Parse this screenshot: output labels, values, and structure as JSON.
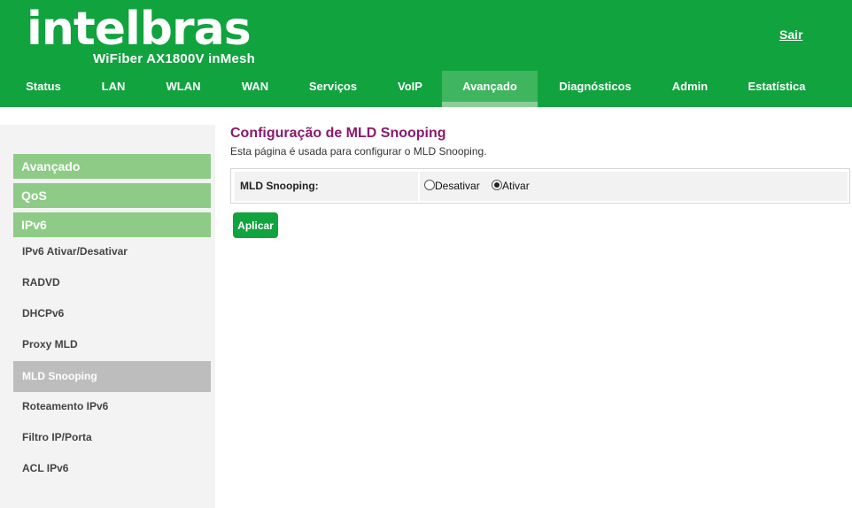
{
  "header": {
    "logo": "intelbras",
    "model": "WiFiber AX1800V inMesh",
    "logout": "Sair"
  },
  "topnav": {
    "tabs": [
      {
        "label": "Status"
      },
      {
        "label": "LAN"
      },
      {
        "label": "WLAN"
      },
      {
        "label": "WAN"
      },
      {
        "label": "Serviços"
      },
      {
        "label": "VoIP"
      },
      {
        "label": "Avançado",
        "active": true
      },
      {
        "label": "Diagnósticos"
      },
      {
        "label": "Admin"
      },
      {
        "label": "Estatística"
      }
    ]
  },
  "sidebar": {
    "groups": [
      {
        "label": "Avançado"
      },
      {
        "label": "QoS"
      },
      {
        "label": "IPv6"
      }
    ],
    "items": [
      {
        "label": "IPv6 Ativar/Desativar"
      },
      {
        "label": "RADVD"
      },
      {
        "label": "DHCPv6"
      },
      {
        "label": "Proxy MLD"
      },
      {
        "label": "MLD Snooping",
        "active": true
      },
      {
        "label": "Roteamento IPv6"
      },
      {
        "label": "Filtro IP/Porta"
      },
      {
        "label": "ACL IPv6"
      }
    ]
  },
  "main": {
    "title": "Configuração de MLD Snooping",
    "description": "Esta página é usada para configurar o MLD Snooping.",
    "field_label": "MLD Snooping:",
    "options": [
      {
        "label": "Desativar",
        "checked": false
      },
      {
        "label": "Ativar",
        "checked": true
      }
    ],
    "apply_label": "Aplicar"
  },
  "colors": {
    "brand_green": "#10a33e",
    "sidebar_group": "#8dcb86",
    "title_purple": "#8a1a6e"
  }
}
